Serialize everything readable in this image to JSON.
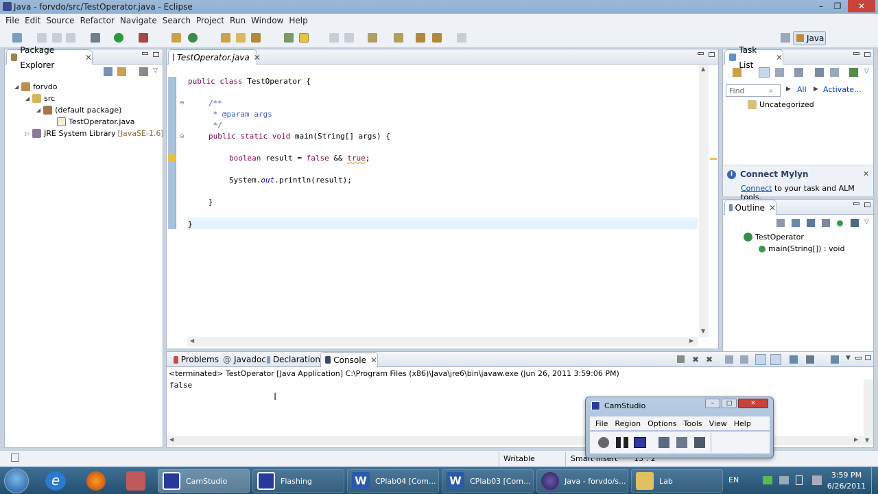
{
  "window": {
    "title": "Java - forvdo/src/TestOperator.java - Eclipse"
  },
  "menu": [
    "File",
    "Edit",
    "Source",
    "Refactor",
    "Navigate",
    "Search",
    "Project",
    "Run",
    "Window",
    "Help"
  ],
  "perspective": {
    "label": "Java"
  },
  "package_explorer": {
    "tab": "Package Explorer",
    "tree": [
      {
        "label": "forvdo"
      },
      {
        "label": "src"
      },
      {
        "label": "(default package)"
      },
      {
        "label": "TestOperator.java"
      },
      {
        "label": "JRE System Library",
        "suffix": "[JavaSE-1.6]"
      }
    ]
  },
  "editor": {
    "tab": "TestOperator.java",
    "lines": {
      "l1a": "public class ",
      "l1b": "TestOperator {",
      "l2": "/**",
      "l3": " * @param args",
      "l4": " */",
      "l5a": "public static void ",
      "l5b": "main(String[] args) {",
      "l6a": "boolean ",
      "l6b": "result = ",
      "l6c": "false",
      "l6d": " && ",
      "l6e": "true",
      "l6f": ";",
      "l7a": "System.",
      "l7b": "out",
      "l7c": ".println(result);",
      "l8": "}",
      "l9": "}"
    }
  },
  "task_list": {
    "tab": "Task List",
    "find_placeholder": "Find",
    "all": "All",
    "activate": "Activate...",
    "category": "Uncategorized"
  },
  "mylyn": {
    "title": "Connect Mylyn",
    "link": "Connect",
    "text": " to your task and ALM tools."
  },
  "outline": {
    "tab": "Outline",
    "class": "TestOperator",
    "method": "main(String[]) : void"
  },
  "bottom_tabs": [
    "Problems",
    "Javadoc",
    "Declaration",
    "Console"
  ],
  "console": {
    "header": "<terminated> TestOperator [Java Application] C:\\Program Files (x86)\\Java\\jre6\\bin\\javaw.exe (Jun 26, 2011 3:59:06 PM)",
    "output": "false"
  },
  "statusbar": {
    "writable": "Writable",
    "insert": "Smart Insert",
    "pos": "13 : 2"
  },
  "camstudio": {
    "title": "CamStudio",
    "menu": [
      "File",
      "Region",
      "Options",
      "Tools",
      "View",
      "Help"
    ]
  },
  "taskbar": {
    "items": [
      "CamStudio",
      "Flashing",
      "CPlab04 [Com...",
      "CPlab03 [Com...",
      "Java - forvdo/s...",
      "Lab"
    ],
    "lang": "EN",
    "time": "3:59 PM",
    "date": "6/26/2011"
  },
  "colors": {
    "keyword": "#7f0055",
    "comment": "#3f5fbf",
    "field": "#0000c0",
    "link": "#0645ad"
  }
}
